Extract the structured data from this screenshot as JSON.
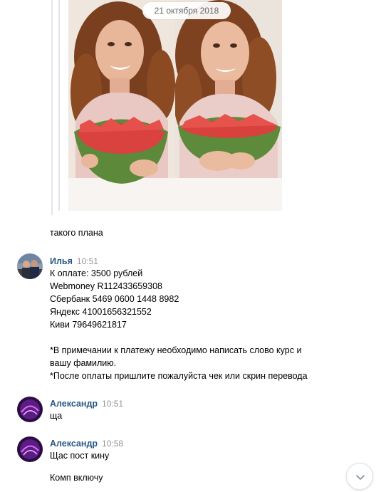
{
  "date_separator": "21 октября 2018",
  "messages": [
    {
      "text": "такого плана"
    },
    {
      "author": "Илья",
      "time": "10:51",
      "lines": [
        "К оплате: 3500 рублей",
        "Webmoney R112433659308",
        "Сбербанк 5469 0600 1448 8982",
        "Яндекс 41001656321552",
        "Киви 79649621817",
        "",
        "*В примечании к платежу необходимо написать слово курс и",
        "вашу фамилию.",
        "*После оплаты пришлите пожалуйста чек или скрин перевода"
      ]
    },
    {
      "author": "Александр",
      "time": "10:51",
      "lines": [
        "ща"
      ]
    },
    {
      "author": "Александр",
      "time": "10:58",
      "lines": [
        "Щас пост кину"
      ]
    },
    {
      "text": "Комп включу"
    }
  ],
  "icons": {
    "scroll_down": "chevron-down-icon"
  },
  "colors": {
    "author_link": "#2a5885",
    "timestamp": "#939393",
    "forward_border": "#e1e5eb"
  }
}
